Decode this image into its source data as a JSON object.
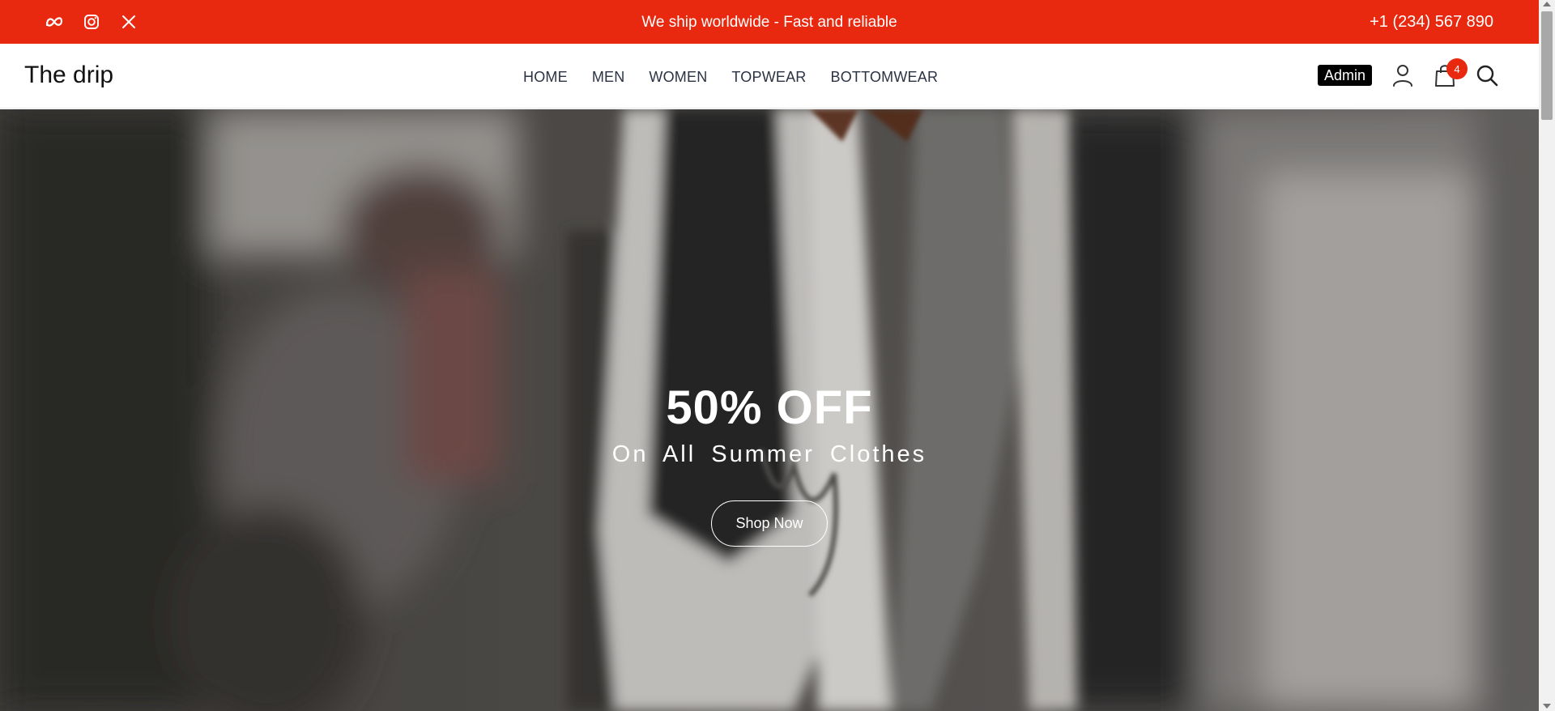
{
  "topbar": {
    "social": [
      {
        "icon": "meta-icon"
      },
      {
        "icon": "instagram-icon"
      },
      {
        "icon": "x-twitter-icon"
      }
    ],
    "message": "We ship worldwide - Fast and reliable",
    "phone": "+1 (234) 567 890",
    "background": "#e8290f"
  },
  "navbar": {
    "logo": "The drip",
    "links": [
      "HOME",
      "MEN",
      "WOMEN",
      "TOPWEAR",
      "BOTTOMWEAR"
    ],
    "admin_label": "Admin",
    "cart_count": "4",
    "icons": [
      "user-icon",
      "shopping-bag-icon",
      "search-icon"
    ]
  },
  "hero": {
    "title": "50% OFF",
    "subtitle": "On All Summer Clothes",
    "button": "Shop Now"
  },
  "colors": {
    "accent": "#e8290f",
    "nav_text": "#2b3342"
  }
}
